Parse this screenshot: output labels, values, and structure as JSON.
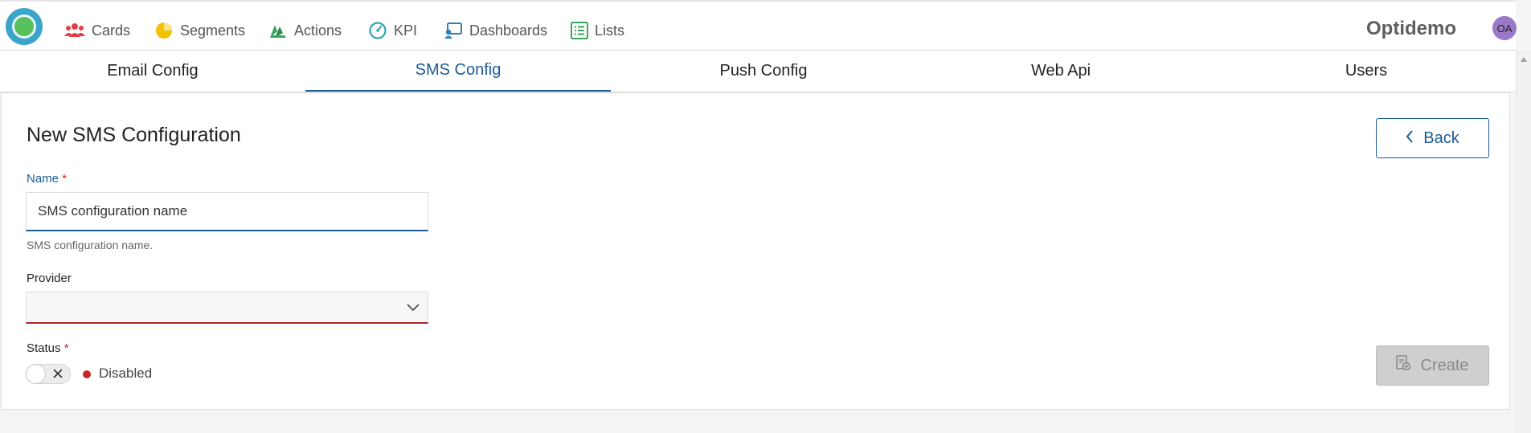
{
  "nav": {
    "items": [
      {
        "label": "Cards",
        "icon": "users-icon",
        "color": "#e0404a"
      },
      {
        "label": "Segments",
        "icon": "pie-chart-icon",
        "color": "#f2c200"
      },
      {
        "label": "Actions",
        "icon": "actions-icon",
        "color": "#3aa560"
      },
      {
        "label": "KPI",
        "icon": "gauge-icon",
        "color": "#2fa4b8"
      },
      {
        "label": "Dashboards",
        "icon": "dashboard-icon",
        "color": "#2f7fb8"
      },
      {
        "label": "Lists",
        "icon": "list-icon",
        "color": "#3aa560"
      }
    ],
    "brand": "Optidemo",
    "avatar": "OA"
  },
  "tabs": [
    {
      "label": "Email Config",
      "active": false
    },
    {
      "label": "SMS Config",
      "active": true
    },
    {
      "label": "Push Config",
      "active": false
    },
    {
      "label": "Web Api",
      "active": false
    },
    {
      "label": "Users",
      "active": false
    }
  ],
  "form": {
    "title": "New SMS Configuration",
    "back_label": "Back",
    "name_label": "Name",
    "required_mark": "*",
    "name_value": "SMS configuration name",
    "name_help": "SMS configuration name.",
    "provider_label": "Provider",
    "provider_value": "",
    "status_label": "Status",
    "status_value": "Disabled",
    "create_label": "Create"
  },
  "colors": {
    "accent": "#1d5c97",
    "error": "#c62828",
    "logo": "#3aa5c9"
  }
}
